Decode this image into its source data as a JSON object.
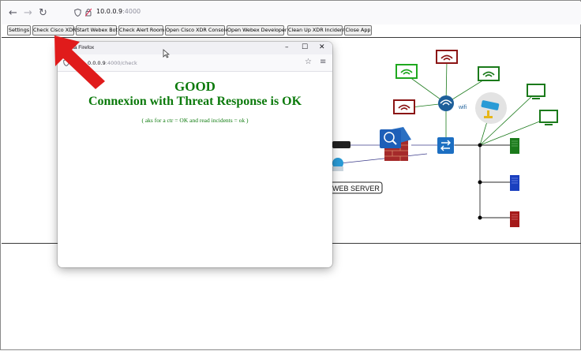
{
  "browser": {
    "back_icon": "arrow-left-icon",
    "forward_icon": "arrow-right-icon",
    "reload_icon": "reload-icon",
    "url_host": "10.0.0.9",
    "url_port": ":4000"
  },
  "toolbar": {
    "buttons": [
      "Settings",
      "Check Cisco XDR",
      "Start Webex Bot",
      "Check Alert Room",
      "Open Cisco XDR Console",
      "Open Webex Developer",
      "Clean Up XDR Incident",
      "Close App"
    ]
  },
  "diagram": {
    "wifi_label": "wifi",
    "web_server_label": "WEB SERVER",
    "colors": {
      "green": "#1fa81f",
      "dark_red": "#8b1515",
      "dark_green": "#1b7a1b",
      "blue": "#1a5fbf",
      "cisco_blue": "#1d6fc2"
    }
  },
  "popup": {
    "title": "lla Firefox",
    "url_host": "0.0.0.9",
    "url_path": ":4000/check",
    "heading": "GOOD",
    "message": "Connexion with Threat Response is OK",
    "detail": "( aks for a ctr = OK and read incidents = ok )",
    "controls": {
      "minimize": "–",
      "maximize": "☐",
      "close": "✕"
    }
  },
  "annotation": {
    "arrow_color": "#e01b1b"
  }
}
